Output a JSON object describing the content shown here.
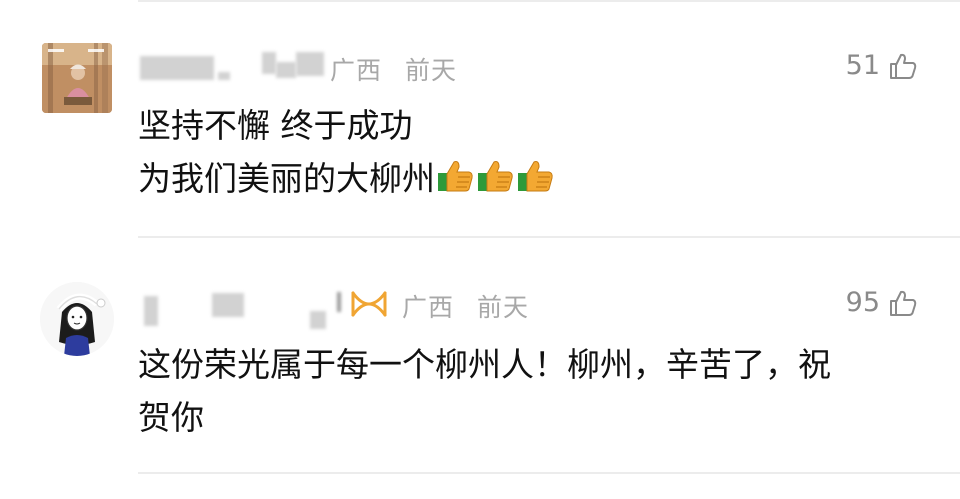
{
  "comments": [
    {
      "location": "广西",
      "time": "前天",
      "likes": "51",
      "lines": [
        "坚持不懈 终于成功",
        "为我们美丽的大柳州"
      ],
      "emojis": [
        "thumbs-up-icon",
        "thumbs-up-icon",
        "thumbs-up-icon"
      ]
    },
    {
      "location": "广西",
      "time": "前天",
      "likes": "95",
      "lines": [
        "这份荣光属于每一个柳州人！柳州，辛苦了，祝",
        "贺你"
      ]
    }
  ],
  "colors": {
    "meta": "#a8a8a8",
    "text": "#111111",
    "divider": "#ececec",
    "badge": "#f0a533"
  }
}
